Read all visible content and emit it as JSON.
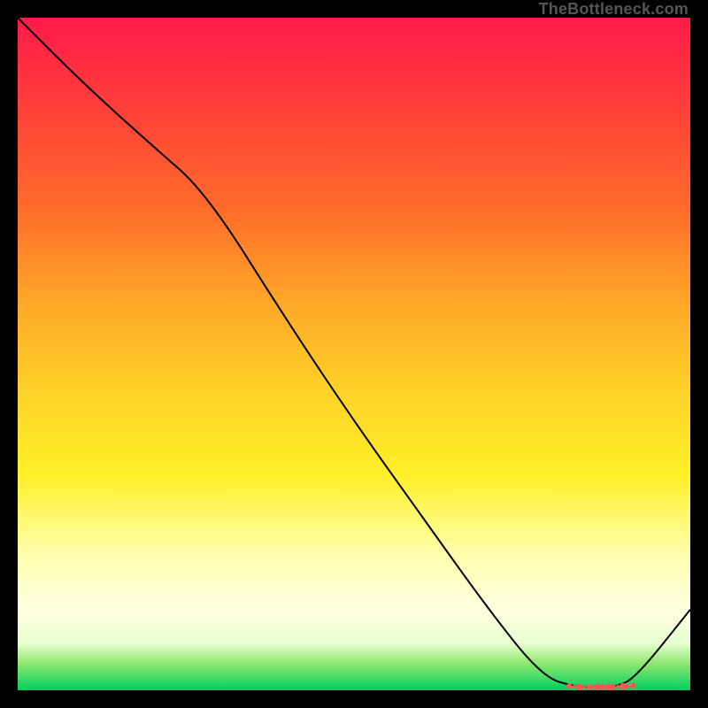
{
  "watermark": "TheBottleneck.com",
  "colors": {
    "curve": "#000000",
    "marker": "#ff5555",
    "top_gradient": "#ff1a4a",
    "bottom_gradient": "#00d060"
  },
  "chart_data": {
    "type": "line",
    "title": "",
    "xlabel": "",
    "ylabel": "",
    "xlim": [
      0,
      100
    ],
    "ylim": [
      0,
      100
    ],
    "x": [
      0,
      10,
      20,
      28,
      40,
      50,
      60,
      70,
      78,
      83,
      86,
      89,
      92,
      100
    ],
    "values": [
      100,
      90,
      81,
      74,
      55,
      40,
      26,
      12,
      2,
      0.5,
      0.5,
      0.5,
      2,
      12
    ],
    "optimal_range_x": [
      82,
      83.5,
      85,
      86.2,
      87,
      87.8,
      88.5,
      90,
      91.5
    ],
    "optimal_range_y": [
      0.6,
      0.5,
      0.5,
      0.5,
      0.5,
      0.5,
      0.5,
      0.6,
      0.7
    ],
    "annotations": []
  }
}
